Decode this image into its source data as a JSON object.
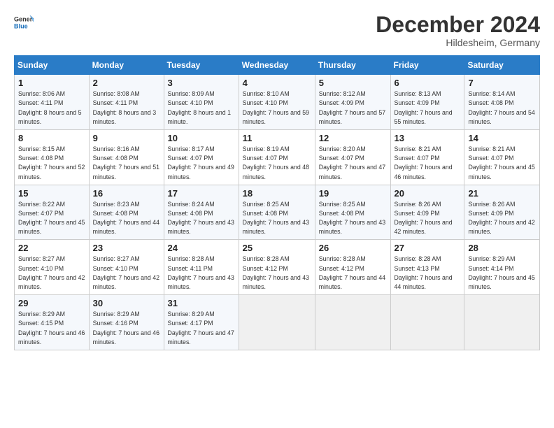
{
  "header": {
    "logo_general": "General",
    "logo_blue": "Blue",
    "month_title": "December 2024",
    "subtitle": "Hildesheim, Germany"
  },
  "days_of_week": [
    "Sunday",
    "Monday",
    "Tuesday",
    "Wednesday",
    "Thursday",
    "Friday",
    "Saturday"
  ],
  "weeks": [
    [
      {
        "day": "1",
        "sunrise": "Sunrise: 8:06 AM",
        "sunset": "Sunset: 4:11 PM",
        "daylight": "Daylight: 8 hours and 5 minutes."
      },
      {
        "day": "2",
        "sunrise": "Sunrise: 8:08 AM",
        "sunset": "Sunset: 4:11 PM",
        "daylight": "Daylight: 8 hours and 3 minutes."
      },
      {
        "day": "3",
        "sunrise": "Sunrise: 8:09 AM",
        "sunset": "Sunset: 4:10 PM",
        "daylight": "Daylight: 8 hours and 1 minute."
      },
      {
        "day": "4",
        "sunrise": "Sunrise: 8:10 AM",
        "sunset": "Sunset: 4:10 PM",
        "daylight": "Daylight: 7 hours and 59 minutes."
      },
      {
        "day": "5",
        "sunrise": "Sunrise: 8:12 AM",
        "sunset": "Sunset: 4:09 PM",
        "daylight": "Daylight: 7 hours and 57 minutes."
      },
      {
        "day": "6",
        "sunrise": "Sunrise: 8:13 AM",
        "sunset": "Sunset: 4:09 PM",
        "daylight": "Daylight: 7 hours and 55 minutes."
      },
      {
        "day": "7",
        "sunrise": "Sunrise: 8:14 AM",
        "sunset": "Sunset: 4:08 PM",
        "daylight": "Daylight: 7 hours and 54 minutes."
      }
    ],
    [
      {
        "day": "8",
        "sunrise": "Sunrise: 8:15 AM",
        "sunset": "Sunset: 4:08 PM",
        "daylight": "Daylight: 7 hours and 52 minutes."
      },
      {
        "day": "9",
        "sunrise": "Sunrise: 8:16 AM",
        "sunset": "Sunset: 4:08 PM",
        "daylight": "Daylight: 7 hours and 51 minutes."
      },
      {
        "day": "10",
        "sunrise": "Sunrise: 8:17 AM",
        "sunset": "Sunset: 4:07 PM",
        "daylight": "Daylight: 7 hours and 49 minutes."
      },
      {
        "day": "11",
        "sunrise": "Sunrise: 8:19 AM",
        "sunset": "Sunset: 4:07 PM",
        "daylight": "Daylight: 7 hours and 48 minutes."
      },
      {
        "day": "12",
        "sunrise": "Sunrise: 8:20 AM",
        "sunset": "Sunset: 4:07 PM",
        "daylight": "Daylight: 7 hours and 47 minutes."
      },
      {
        "day": "13",
        "sunrise": "Sunrise: 8:21 AM",
        "sunset": "Sunset: 4:07 PM",
        "daylight": "Daylight: 7 hours and 46 minutes."
      },
      {
        "day": "14",
        "sunrise": "Sunrise: 8:21 AM",
        "sunset": "Sunset: 4:07 PM",
        "daylight": "Daylight: 7 hours and 45 minutes."
      }
    ],
    [
      {
        "day": "15",
        "sunrise": "Sunrise: 8:22 AM",
        "sunset": "Sunset: 4:07 PM",
        "daylight": "Daylight: 7 hours and 45 minutes."
      },
      {
        "day": "16",
        "sunrise": "Sunrise: 8:23 AM",
        "sunset": "Sunset: 4:08 PM",
        "daylight": "Daylight: 7 hours and 44 minutes."
      },
      {
        "day": "17",
        "sunrise": "Sunrise: 8:24 AM",
        "sunset": "Sunset: 4:08 PM",
        "daylight": "Daylight: 7 hours and 43 minutes."
      },
      {
        "day": "18",
        "sunrise": "Sunrise: 8:25 AM",
        "sunset": "Sunset: 4:08 PM",
        "daylight": "Daylight: 7 hours and 43 minutes."
      },
      {
        "day": "19",
        "sunrise": "Sunrise: 8:25 AM",
        "sunset": "Sunset: 4:08 PM",
        "daylight": "Daylight: 7 hours and 43 minutes."
      },
      {
        "day": "20",
        "sunrise": "Sunrise: 8:26 AM",
        "sunset": "Sunset: 4:09 PM",
        "daylight": "Daylight: 7 hours and 42 minutes."
      },
      {
        "day": "21",
        "sunrise": "Sunrise: 8:26 AM",
        "sunset": "Sunset: 4:09 PM",
        "daylight": "Daylight: 7 hours and 42 minutes."
      }
    ],
    [
      {
        "day": "22",
        "sunrise": "Sunrise: 8:27 AM",
        "sunset": "Sunset: 4:10 PM",
        "daylight": "Daylight: 7 hours and 42 minutes."
      },
      {
        "day": "23",
        "sunrise": "Sunrise: 8:27 AM",
        "sunset": "Sunset: 4:10 PM",
        "daylight": "Daylight: 7 hours and 42 minutes."
      },
      {
        "day": "24",
        "sunrise": "Sunrise: 8:28 AM",
        "sunset": "Sunset: 4:11 PM",
        "daylight": "Daylight: 7 hours and 43 minutes."
      },
      {
        "day": "25",
        "sunrise": "Sunrise: 8:28 AM",
        "sunset": "Sunset: 4:12 PM",
        "daylight": "Daylight: 7 hours and 43 minutes."
      },
      {
        "day": "26",
        "sunrise": "Sunrise: 8:28 AM",
        "sunset": "Sunset: 4:12 PM",
        "daylight": "Daylight: 7 hours and 44 minutes."
      },
      {
        "day": "27",
        "sunrise": "Sunrise: 8:28 AM",
        "sunset": "Sunset: 4:13 PM",
        "daylight": "Daylight: 7 hours and 44 minutes."
      },
      {
        "day": "28",
        "sunrise": "Sunrise: 8:29 AM",
        "sunset": "Sunset: 4:14 PM",
        "daylight": "Daylight: 7 hours and 45 minutes."
      }
    ],
    [
      {
        "day": "29",
        "sunrise": "Sunrise: 8:29 AM",
        "sunset": "Sunset: 4:15 PM",
        "daylight": "Daylight: 7 hours and 46 minutes."
      },
      {
        "day": "30",
        "sunrise": "Sunrise: 8:29 AM",
        "sunset": "Sunset: 4:16 PM",
        "daylight": "Daylight: 7 hours and 46 minutes."
      },
      {
        "day": "31",
        "sunrise": "Sunrise: 8:29 AM",
        "sunset": "Sunset: 4:17 PM",
        "daylight": "Daylight: 7 hours and 47 minutes."
      },
      null,
      null,
      null,
      null
    ]
  ]
}
